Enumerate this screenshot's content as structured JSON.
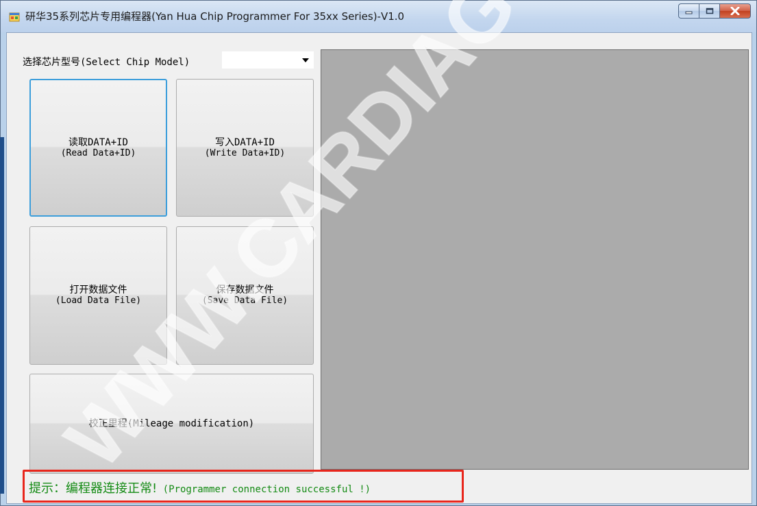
{
  "window": {
    "title": "研华35系列芯片专用编程器(Yan Hua Chip Programmer For 35xx Series)-V1.0"
  },
  "chip_select": {
    "label": "选择芯片型号(Select Chip Model)",
    "value": ""
  },
  "buttons": {
    "read": {
      "line1": "读取DATA+ID",
      "line2": "(Read Data+ID)"
    },
    "write": {
      "line1": "写入DATA+ID",
      "line2": "(Write Data+ID)"
    },
    "load": {
      "line1": "打开数据文件",
      "line2": "(Load Data File)"
    },
    "save": {
      "line1": "保存数据文件",
      "line2": "(Save Data File)"
    },
    "mileage": {
      "label": "校正里程(Mileage modification)"
    }
  },
  "status": {
    "prefix": "提示：编程器连接正常!",
    "message": "(Programmer connection successful !)"
  },
  "watermark": {
    "text": "WWW.CARDIAGTOOL"
  },
  "colors": {
    "status_text": "#138a13",
    "highlight_border": "#e8261c",
    "focus_border": "#3c9edb",
    "data_panel": "#ababab"
  },
  "icons": {
    "app": "app-window-icon",
    "minimize": "minimize-icon",
    "maximize": "maximize-icon",
    "close": "close-icon",
    "dropdown": "chevron-down-icon"
  }
}
